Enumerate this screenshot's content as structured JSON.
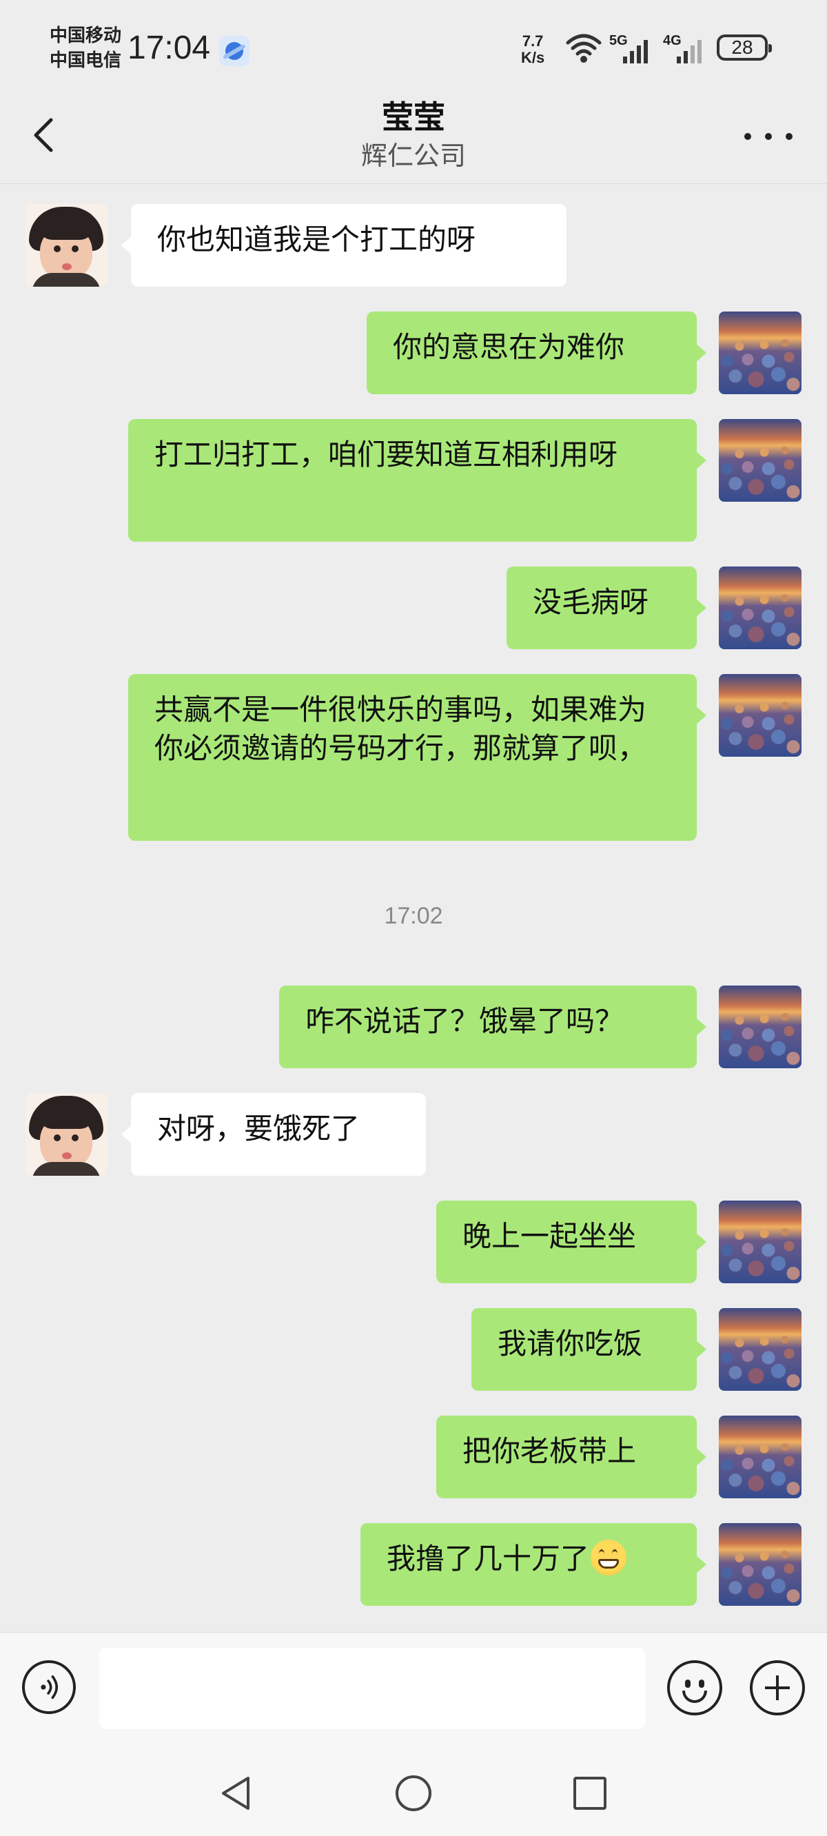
{
  "status_bar": {
    "carrier_1": "中国移动",
    "carrier_2": "中国电信",
    "time": "17:04",
    "net_speed_value": "7.7",
    "net_speed_unit": "K/s",
    "signal_1_label": "5G",
    "signal_2_label": "4G",
    "battery": "28"
  },
  "header": {
    "title": "莹莹",
    "subtitle": "辉仁公司"
  },
  "messages": [
    {
      "side": "left",
      "text": "你也知道我是个打工的呀",
      "avatar": "kid-avatar"
    },
    {
      "side": "right",
      "text": "你的意思在为难你",
      "avatar": "pebbles-avatar"
    },
    {
      "side": "right",
      "text": "打工归打工，咱们要知道互相利用呀",
      "avatar": "pebbles-avatar"
    },
    {
      "side": "right",
      "text": "没毛病呀",
      "avatar": "pebbles-avatar"
    },
    {
      "side": "right",
      "text": "共赢不是一件很快乐的事吗，如果难为你必须邀请的号码才行，那就算了呗，",
      "avatar": "pebbles-avatar"
    },
    {
      "side": "right",
      "text": "咋不说话了？饿晕了吗？",
      "avatar": "pebbles-avatar"
    },
    {
      "side": "left",
      "text": "对呀，要饿死了",
      "avatar": "kid-avatar"
    },
    {
      "side": "right",
      "text": "晚上一起坐坐",
      "avatar": "pebbles-avatar"
    },
    {
      "side": "right",
      "text": "我请你吃饭",
      "avatar": "pebbles-avatar"
    },
    {
      "side": "right",
      "text": "把你老板带上",
      "avatar": "pebbles-avatar"
    },
    {
      "side": "right",
      "text": "我撸了几十万了",
      "emoji": "grinning-face-emoji",
      "avatar": "pebbles-avatar"
    }
  ],
  "timestamp": "17:02",
  "input_bar": {
    "value": "",
    "placeholder": "",
    "icons": [
      "voice-icon",
      "emoji-icon",
      "plus-icon"
    ]
  },
  "colors": {
    "background": "#ededed",
    "bubble_self": "#a9e878",
    "bubble_other": "#ffffff"
  }
}
